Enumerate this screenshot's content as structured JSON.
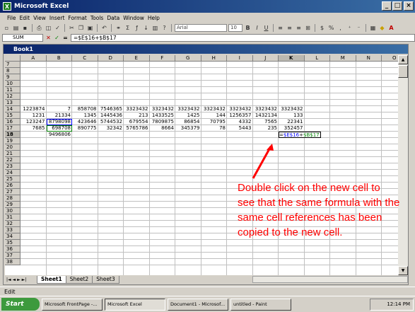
{
  "app": {
    "title": "Microsoft Excel"
  },
  "menu": [
    "File",
    "Edit",
    "View",
    "Insert",
    "Format",
    "Tools",
    "Data",
    "Window",
    "Help"
  ],
  "toolbar": {
    "font_name": "Arial",
    "font_size": "10"
  },
  "formula_bar": {
    "name_box": "SUM",
    "formula": "=$E$16+$B$17"
  },
  "workbook": {
    "title": "Book1"
  },
  "columns": [
    "A",
    "B",
    "C",
    "D",
    "E",
    "F",
    "G",
    "H",
    "I",
    "J",
    "K",
    "L",
    "M",
    "N",
    "O"
  ],
  "rows": [
    "7",
    "8",
    "9",
    "10",
    "11",
    "12",
    "13",
    "14",
    "15",
    "16",
    "17",
    "18",
    "19",
    "20",
    "21",
    "22",
    "23",
    "24",
    "25",
    "26",
    "27",
    "28",
    "29",
    "30",
    "31",
    "32",
    "33",
    "34",
    "35",
    "36",
    "37",
    "38"
  ],
  "cells": {
    "r14": [
      "1223874",
      "7",
      "858708",
      "7546365",
      "3323432",
      "3323432",
      "3323432",
      "3323432",
      "3323432",
      "3323432",
      "3323432"
    ],
    "r15": [
      "1231",
      "21334",
      "1345",
      "1445436",
      "213",
      "1433525",
      "1425",
      "144",
      "1256357",
      "1432134",
      "133"
    ],
    "r16": [
      "123247",
      "8798098",
      "423646",
      "5744532",
      "679554",
      "7809875",
      "86854",
      "70795",
      "4332",
      "7565",
      "22341"
    ],
    "r17": [
      "7685",
      "698708",
      "890775",
      "32342",
      "5765786",
      "8664",
      "345379",
      "78",
      "5443",
      "235",
      "352457"
    ],
    "r18_b": "9496806",
    "r18_k_prefix": "=",
    "r18_k_ref1": "$E$16",
    "r18_k_plus": "+",
    "r18_k_ref2": "$B$17"
  },
  "sheet_tabs": [
    "Sheet1",
    "Sheet2",
    "Sheet3"
  ],
  "status": {
    "text": "Edit"
  },
  "taskbar": {
    "start": "Start",
    "tasks": [
      "Microsoft FrontPage -...",
      "Microsoft Excel",
      "Document1 - Microsof...",
      "untitled - Paint"
    ],
    "clock": "12:14 PM"
  },
  "annotation": {
    "text": "Double click on the new cell to see that the same formula with the same cell references has been copied to the new cell."
  },
  "colors": {
    "title_gradient_start": "#0a246a",
    "annotation": "#ff0000",
    "ref_blue": "#0000ff",
    "ref_green": "#008000"
  }
}
